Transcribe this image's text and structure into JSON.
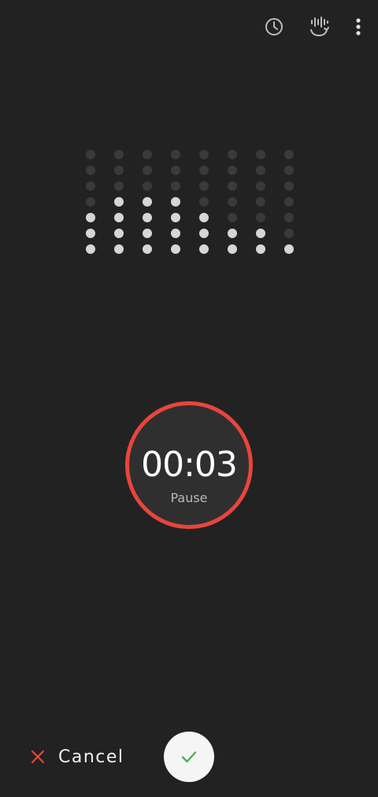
{
  "toolbar": {
    "history_icon": "history-clock-icon",
    "converter_icon": "speech-to-text-icon",
    "more_icon": "more-vertical-icon"
  },
  "visualizer": {
    "rows": 7,
    "levels": [
      3,
      4,
      4,
      4,
      3,
      2,
      2,
      1
    ]
  },
  "timer": {
    "time": "00:03",
    "state_label": "Pause"
  },
  "actions": {
    "cancel_label": "Cancel",
    "confirm_icon": "check-icon"
  },
  "colors": {
    "background": "#222222",
    "accent_red": "#e8453c",
    "confirm_green": "#4caf50",
    "dot_active": "#d6d6d6",
    "dot_inactive": "#3a3a3a"
  }
}
